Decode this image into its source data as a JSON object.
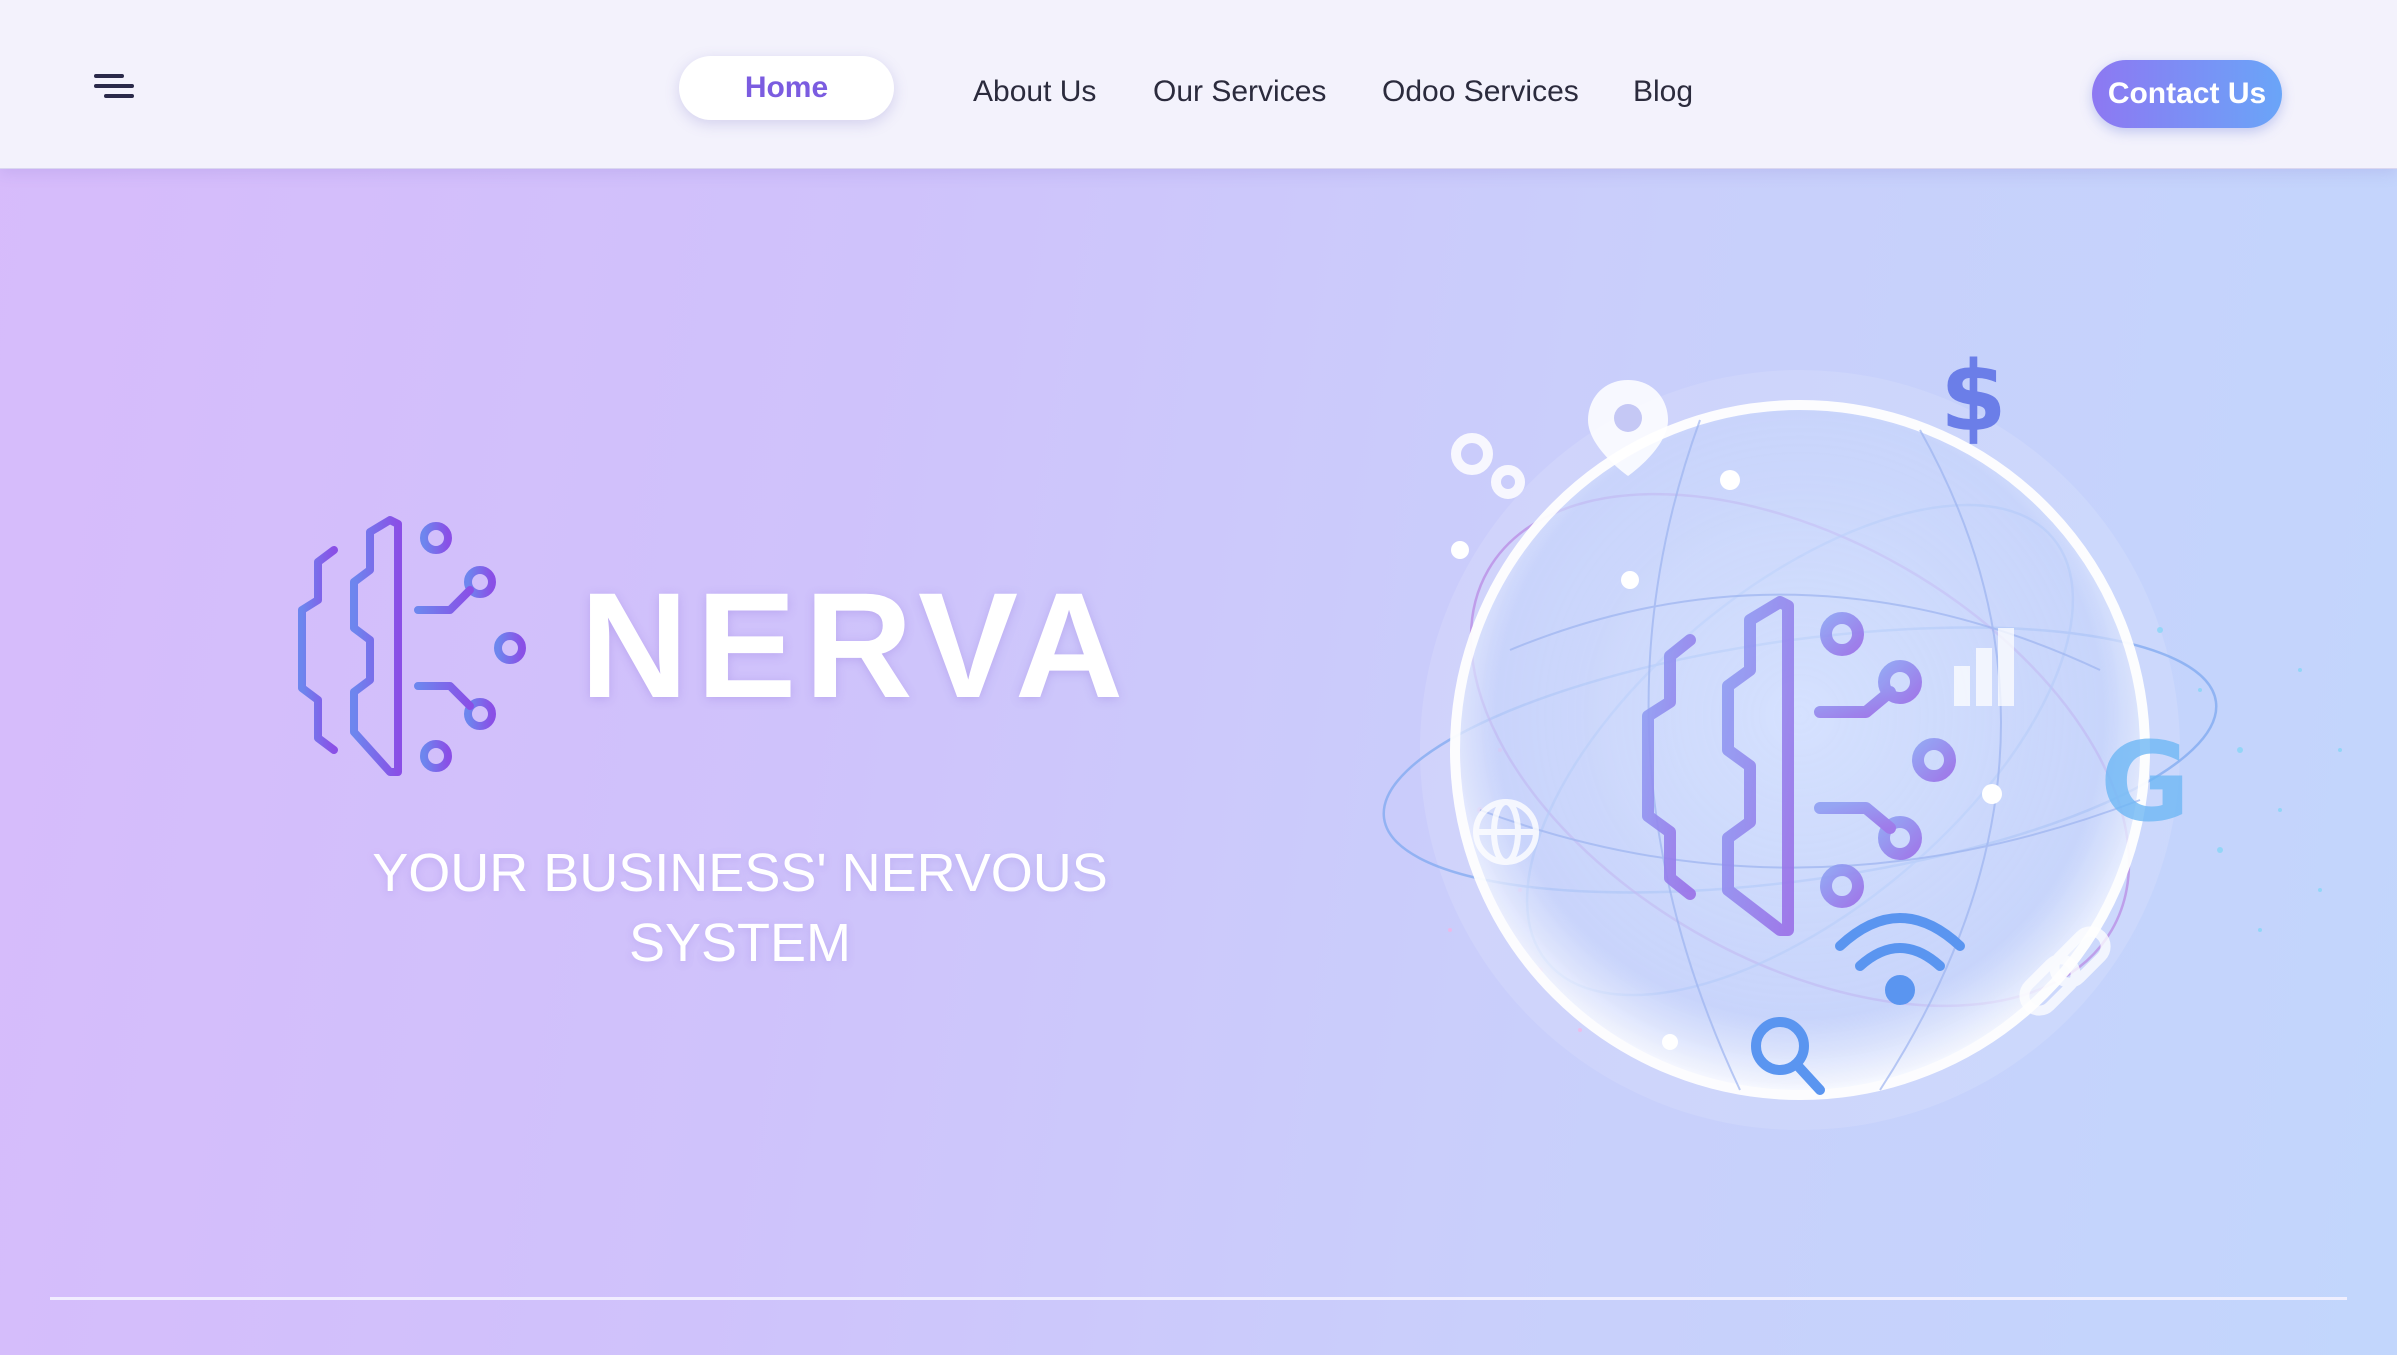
{
  "nav": {
    "items": [
      {
        "label": "Home",
        "active": true
      },
      {
        "label": "About Us"
      },
      {
        "label": "Our Services"
      },
      {
        "label": "Odoo Services"
      },
      {
        "label": "Blog"
      }
    ],
    "contact_label": "Contact Us"
  },
  "hero": {
    "brand": "NERVA",
    "tagline_line1": "YOUR BUSINESS' NERVOUS",
    "tagline_line2": "SYSTEM",
    "illustration_icons": [
      "location-pin-icon",
      "dollar-icon",
      "gear-icon",
      "bar-chart-icon",
      "globe-icon",
      "wifi-icon",
      "magnifier-icon",
      "google-icon",
      "link-icon"
    ]
  },
  "colors": {
    "accent": "#7b5ce0",
    "contact_gradient_start": "#8d78f2",
    "contact_gradient_end": "#6aa5f8",
    "hero_gradient_start": "#d7bbfb",
    "hero_gradient_end": "#c2d6fc"
  }
}
